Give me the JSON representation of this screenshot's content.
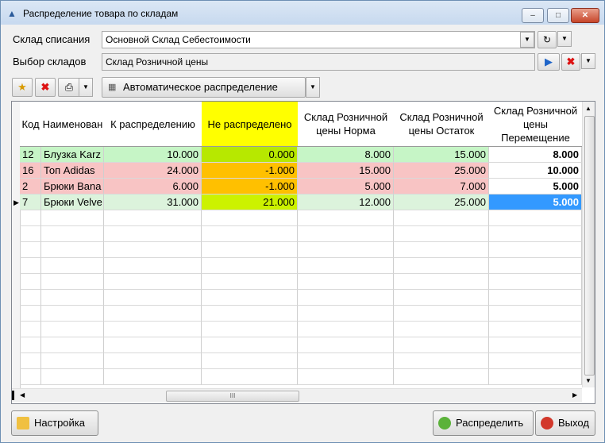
{
  "window": {
    "title": "Распределение товара по складам"
  },
  "form": {
    "writeoff_label": "Склад списания",
    "writeoff_value": "Основной Склад Себестоимости",
    "select_label": "Выбор складов",
    "select_value": "Склад Розничной цены"
  },
  "toolbar": {
    "auto_label": "Автоматическое распределение"
  },
  "grid": {
    "headers": [
      "Код",
      "Наименован",
      "К распределению",
      "Не распределено",
      "Склад Розничной цены Норма",
      "Склад Розничной цены Остаток",
      "Склад Розничной цены Перемещение"
    ],
    "rows": [
      {
        "code": "12",
        "name": "Блузка Karz",
        "to_dist": "10.000",
        "not_dist": "0.000",
        "norma": "8.000",
        "ostatok": "15.000",
        "move": "8.000"
      },
      {
        "code": "16",
        "name": "Топ Adidas",
        "to_dist": "24.000",
        "not_dist": "-1.000",
        "norma": "15.000",
        "ostatok": "25.000",
        "move": "10.000"
      },
      {
        "code": "2",
        "name": "Брюки Bana",
        "to_dist": "6.000",
        "not_dist": "-1.000",
        "norma": "5.000",
        "ostatok": "7.000",
        "move": "5.000"
      },
      {
        "code": "7",
        "name": "Брюки Velve",
        "to_dist": "31.000",
        "not_dist": "21.000",
        "norma": "12.000",
        "ostatok": "25.000",
        "move": "5.000"
      }
    ],
    "hscroll_grip": "III",
    "row_colors": [
      "#c6f5c6",
      "#f8c4c4",
      "#f8c4c4",
      "#dcf3dc"
    ],
    "notdist_colors": [
      "#b7e800",
      "#ffc000",
      "#ffc000",
      "#ccf200"
    ],
    "header_highlight": "#ffff00",
    "selected_cell": "#3399ff"
  },
  "buttons": {
    "settings": "Настройка",
    "distribute": "Распределить",
    "exit": "Выход"
  }
}
